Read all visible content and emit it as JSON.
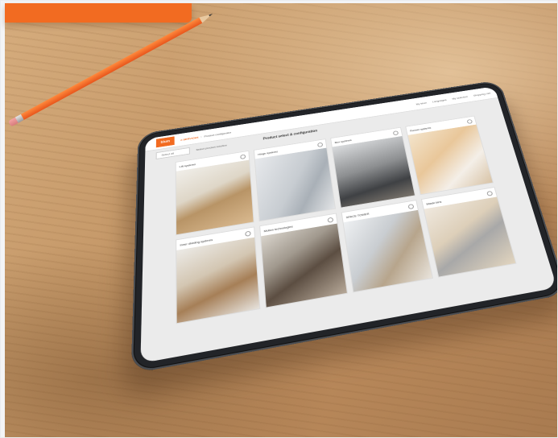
{
  "scene": {
    "description_objects": [
      "wooden-desk",
      "orange-folder",
      "orange-pencil",
      "tablet"
    ],
    "colors": {
      "folder": "#f26b21",
      "pencil": "#e8551b",
      "brand": "#f26b21",
      "desk": "#c49767"
    }
  },
  "app": {
    "brand": "blum",
    "breadcrumb": {
      "home": "e-SERVICES",
      "current": "Product configurator"
    },
    "nav": [
      "My blum",
      "Languages",
      "My selection",
      "Shopping cart"
    ],
    "select_value": "Select all",
    "hint": "Select product solution",
    "page_title": "Product select & configuration"
  },
  "tiles": [
    {
      "label": "Lift systems",
      "icon": "info-icon"
    },
    {
      "label": "Hinge systems",
      "icon": "info-icon"
    },
    {
      "label": "Box systems",
      "icon": "info-icon"
    },
    {
      "label": "Runner systems",
      "icon": "info-icon"
    },
    {
      "label": "Inner dividing systems",
      "icon": "info-icon"
    },
    {
      "label": "Motion technologies",
      "icon": "info-icon"
    },
    {
      "label": "SPACE TOWER",
      "icon": "info-icon"
    },
    {
      "label": "Waste bins",
      "icon": "info-icon"
    }
  ]
}
